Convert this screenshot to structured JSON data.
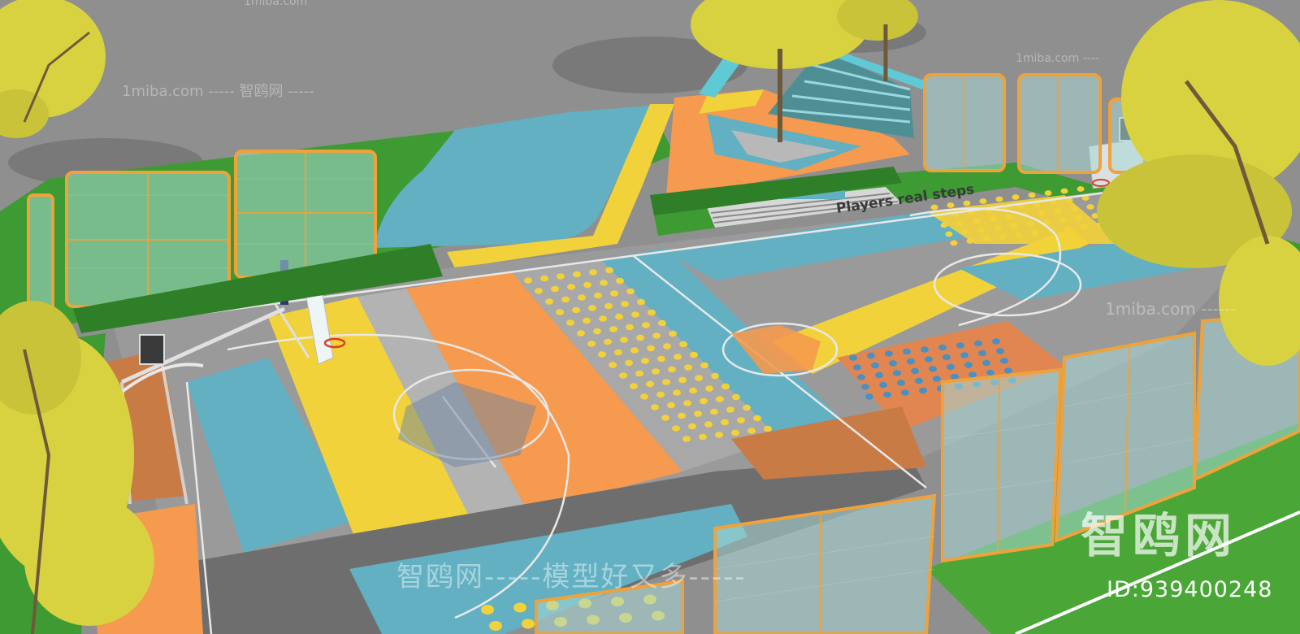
{
  "scene": {
    "description_kind": "3d-render",
    "colors": {
      "ground": "#8f8f8f",
      "grass": "#3e9a32",
      "court_orange": "#f59a4e",
      "court_yellow": "#f2d23a",
      "court_teal": "#62b0c2",
      "court_gray": "#9a9a9a",
      "court_dark": "#6e6e6e",
      "fence_frame": "#f0a23a",
      "tree_foliage": "#d8d240"
    },
    "court_text": "Players  real  steps"
  },
  "watermarks": {
    "top_small": "1miba.com",
    "line1": "1miba.com ----- 智鸥网 -----",
    "line2": "1miba.com ------",
    "right_small": "1miba.com ----",
    "center": "智鸥网-----模型好又多-----",
    "brand": "智鸥网",
    "id": "ID:939400248"
  }
}
